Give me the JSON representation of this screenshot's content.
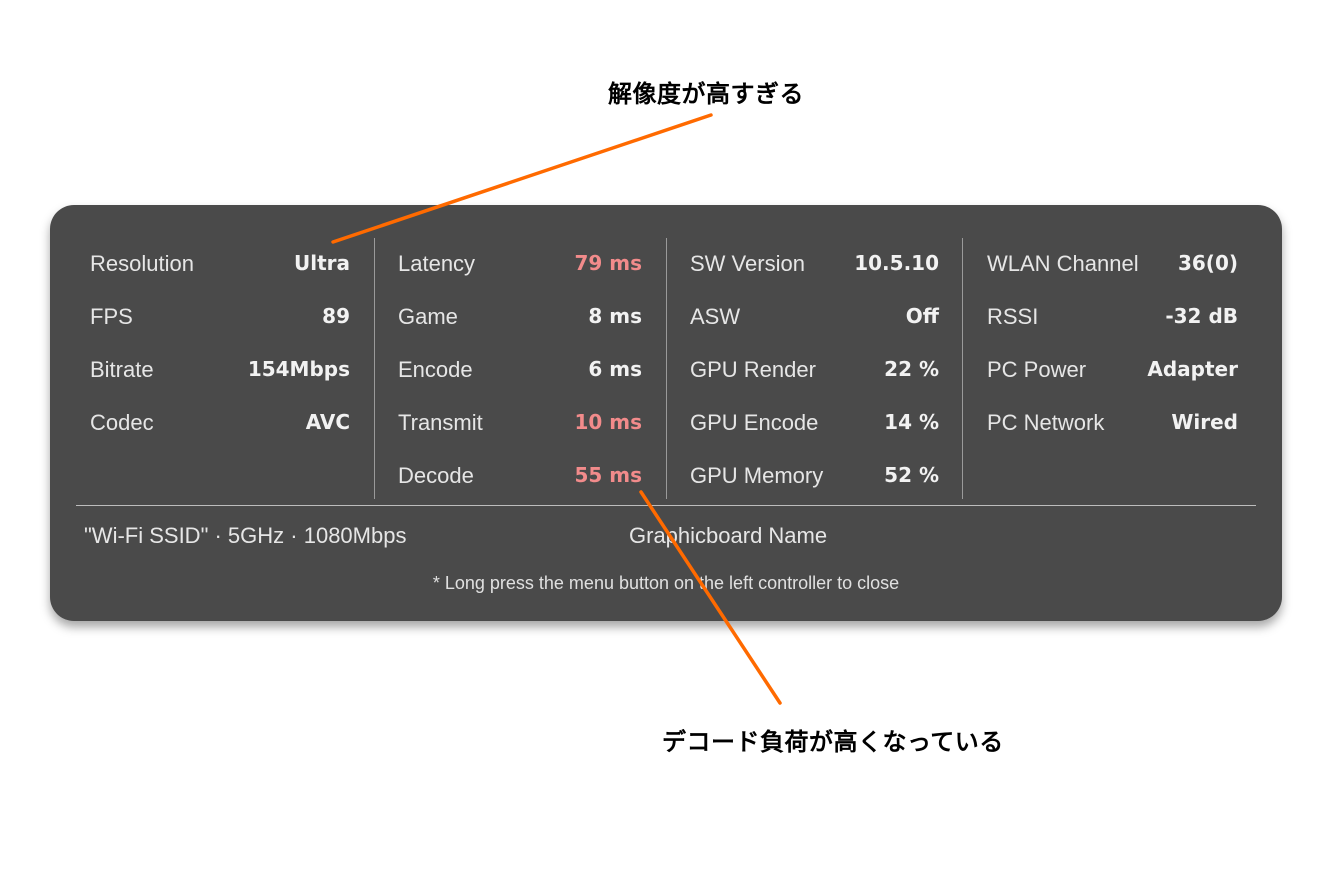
{
  "annotations": {
    "top": "解像度が高すぎる",
    "bottom": "デコード負荷が高くなっている",
    "line_color": "#ff6a00"
  },
  "panel": {
    "background": "#4a4a4a",
    "warn_color": "#f28b8b",
    "col1": [
      {
        "label": "Resolution",
        "value": "Ultra"
      },
      {
        "label": "FPS",
        "value": "89"
      },
      {
        "label": "Bitrate",
        "value": "154Mbps"
      },
      {
        "label": "Codec",
        "value": "AVC"
      }
    ],
    "col2": [
      {
        "label": "Latency",
        "value": "79 ms"
      },
      {
        "label": "Game",
        "value": "8 ms"
      },
      {
        "label": "Encode",
        "value": "6 ms"
      },
      {
        "label": "Transmit",
        "value": "10 ms"
      },
      {
        "label": "Decode",
        "value": "55 ms"
      }
    ],
    "col3": [
      {
        "label": "SW Version",
        "value": "10.5.10"
      },
      {
        "label": "ASW",
        "value": "Off"
      },
      {
        "label": "GPU Render",
        "value": "22 %"
      },
      {
        "label": "GPU Encode",
        "value": "14 %"
      },
      {
        "label": "GPU Memory",
        "value": "52 %"
      }
    ],
    "col4": [
      {
        "label": "WLAN Channel",
        "value": "36(0)"
      },
      {
        "label": "RSSI",
        "value": "-32 dB"
      },
      {
        "label": "PC Power",
        "value": "Adapter"
      },
      {
        "label": "PC Network",
        "value": "Wired"
      }
    ],
    "wifi_info": "\"Wi-Fi SSID\" · 5GHz · 1080Mbps",
    "gpu_name": "Graphicboard Name",
    "hint": "* Long press the menu button on the left controller to close"
  }
}
